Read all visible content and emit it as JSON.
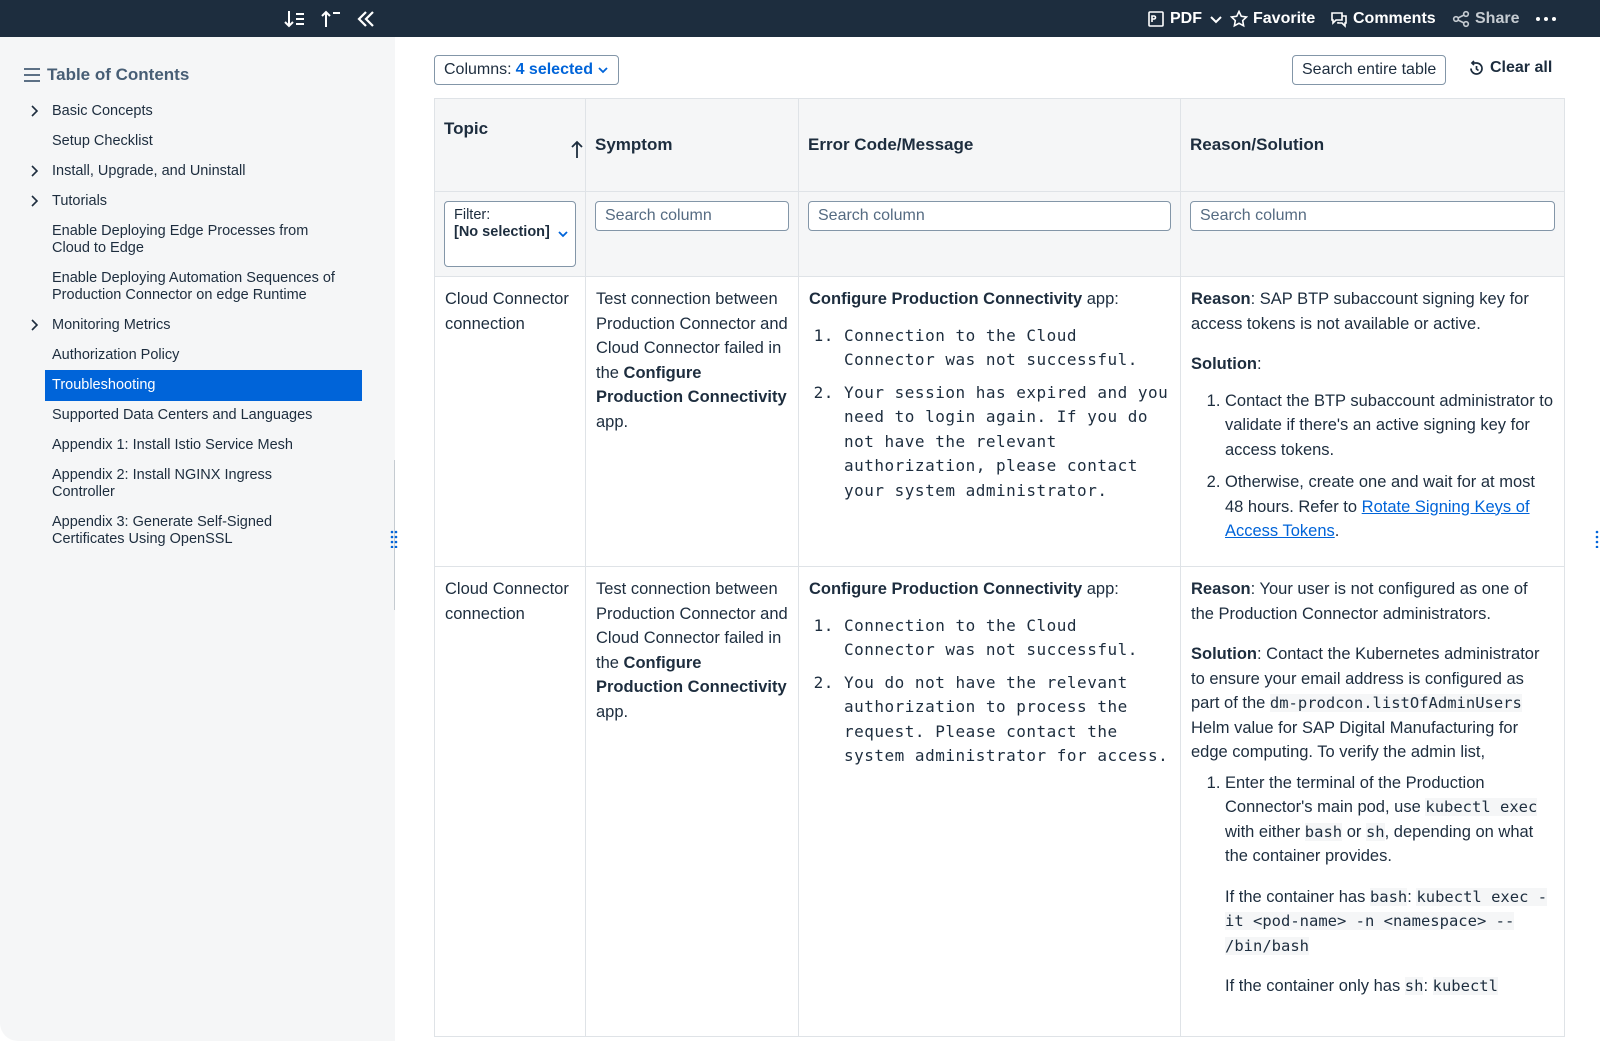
{
  "topbar": {
    "pdf_label": "PDF",
    "favorite_label": "Favorite",
    "comments_label": "Comments",
    "share_label": "Share",
    "colors": {
      "background": "#1d2d3e",
      "text": "#ffffff"
    }
  },
  "toc": {
    "title": "Table of Contents",
    "items": [
      {
        "label": "Basic Concepts",
        "expandable": true
      },
      {
        "label": "Setup Checklist",
        "expandable": false
      },
      {
        "label": "Install, Upgrade, and Uninstall",
        "expandable": true
      },
      {
        "label": "Tutorials",
        "expandable": true
      },
      {
        "label": "Enable Deploying Edge Processes from Cloud to Edge",
        "expandable": false
      },
      {
        "label": "Enable Deploying Automation Sequences of Production Connector on edge Runtime",
        "expandable": false
      },
      {
        "label": "Monitoring Metrics",
        "expandable": true
      },
      {
        "label": "Authorization Policy",
        "expandable": false
      },
      {
        "label": "Troubleshooting",
        "expandable": false,
        "active": true
      },
      {
        "label": "Supported Data Centers and Languages",
        "expandable": false
      },
      {
        "label": "Appendix 1: Install Istio Service Mesh",
        "expandable": false
      },
      {
        "label": "Appendix 2: Install NGINX Ingress Controller",
        "expandable": false
      },
      {
        "label": "Appendix 3: Generate Self-Signed Certificates Using OpenSSL",
        "expandable": false
      }
    ],
    "active_color": "#0064d9"
  },
  "toolbar": {
    "columns_label": "Columns:",
    "columns_value": "4 selected",
    "search_table_label": "Search entire table",
    "clear_all_label": "Clear all"
  },
  "table": {
    "headers": [
      "Topic",
      "Symptom",
      "Error Code/Message",
      "Reason/Solution"
    ],
    "filter": {
      "label": "Filter:",
      "value": "[No selection]"
    },
    "search_placeholder": "Search column",
    "rows": [
      {
        "topic": "Cloud Connector connection",
        "symptom_pre": "Test connection between Production Connector and Cloud Connector failed in the ",
        "symptom_bold": "Configure Production Connectivity",
        "symptom_post": " app.",
        "error_app": "Configure Production Connectivity",
        "error_app_suffix": " app:",
        "error_items": [
          "Connection to the Cloud Connector was not successful.",
          "Your session has expired and you need to login again. If you do not have the relevant authorization, please contact your system administrator."
        ],
        "reason_label": "Reason",
        "reason_text": ": SAP BTP subaccount signing key for access tokens is not available or active.",
        "solution_label": "Solution",
        "solution_suffix": ":",
        "solution_item1": "Contact the BTP subaccount administrator to validate if there's an active signing key for access tokens.",
        "solution_item2_pre": "Otherwise, create one and wait for at most 48 hours. Refer to ",
        "solution_item2_link": "Rotate Signing Keys of Access Tokens",
        "solution_item2_post": "."
      },
      {
        "topic": "Cloud Connector connection",
        "symptom_pre": "Test connection between Production Connector and Cloud Connector failed in the ",
        "symptom_bold": "Configure Production Connectivity",
        "symptom_post": " app.",
        "error_app": "Configure Production Connectivity",
        "error_app_suffix": " app:",
        "error_items": [
          "Connection to the Cloud Connector was not successful.",
          "You do not have the relevant authorization to process the request. Please contact the system administrator for access."
        ],
        "reason_label": "Reason",
        "reason_text": ": Your user is not configured as one of the Production Connector administrators.",
        "solution_label": "Solution",
        "solution_text_pre": ": Contact the Kubernetes administrator to ensure your email address is configured as part of the ",
        "solution_code": "dm-prodcon.listOfAdminUsers",
        "solution_text_post": " Helm value for SAP Digital Manufacturing for edge computing. To verify the admin list,",
        "step1_pre": "Enter the terminal of the Production Connector's main pod, use ",
        "step1_code1": "kubectl exec",
        "step1_mid": " with either ",
        "step1_code2": "bash",
        "step1_or": " or ",
        "step1_code3": "sh",
        "step1_post": ", depending on what the container provides.",
        "bash_pre": "If the container has ",
        "bash_code": "bash",
        "bash_colon": ": ",
        "bash_cmd": "kubectl exec -it <pod-name> -n <namespace> -- /bin/bash",
        "sh_pre": "If the container only has ",
        "sh_code": "sh",
        "sh_colon": ": ",
        "sh_cmd": "kubectl"
      }
    ]
  }
}
